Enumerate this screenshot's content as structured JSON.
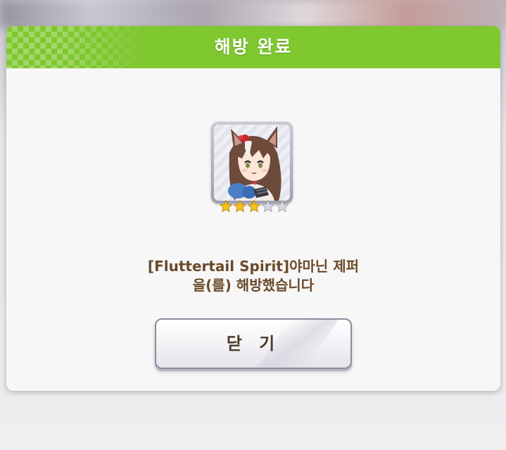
{
  "dialog": {
    "title": "해방 완료",
    "header_color": "#7fc830",
    "message_line1": "[Fluttertail Spirit]야마닌 제퍼",
    "message_line2": "을(를) 해방했습니다",
    "message_color": "#6b4a2a"
  },
  "character_card": {
    "icon": "horse-girl-portrait",
    "rarity_filled": 3,
    "rarity_total": 5,
    "star_filled_color": "#f6c21c",
    "star_empty_color": "#d8d8de"
  },
  "close_button": {
    "label": "닫 기"
  }
}
